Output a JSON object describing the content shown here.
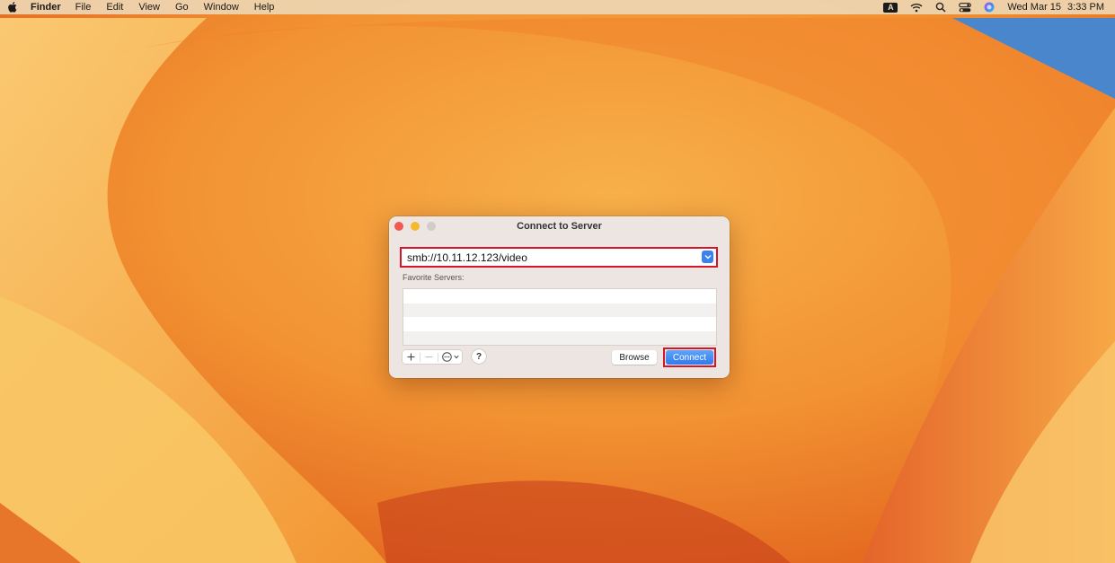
{
  "menubar": {
    "app_name": "Finder",
    "items": [
      "File",
      "Edit",
      "View",
      "Go",
      "Window",
      "Help"
    ],
    "input_badge": "A",
    "date": "Wed Mar 15",
    "time": "3:33 PM",
    "icons": [
      "apple-icon",
      "wifi-icon",
      "search-icon",
      "control-center-icon",
      "siri-icon"
    ]
  },
  "dialog": {
    "title": "Connect to Server",
    "address_value": "smb://10.11.12.123/video",
    "favorites_label": "Favorite Servers:",
    "help_label": "?",
    "browse_label": "Browse",
    "connect_label": "Connect"
  },
  "colors": {
    "highlight": "#d4152a",
    "accent": "#2f7bf0",
    "wallpaper_primary": "#f39a2e"
  }
}
